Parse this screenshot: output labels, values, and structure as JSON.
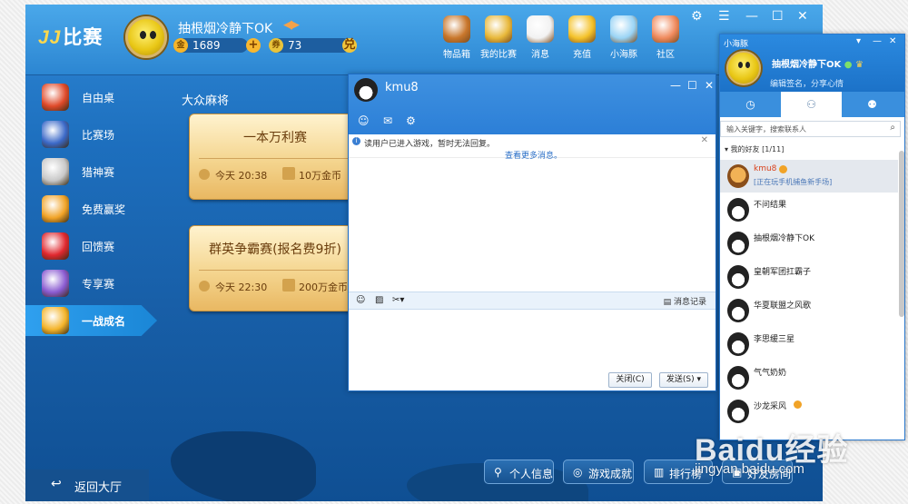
{
  "app": {
    "logo_text": "比赛",
    "username": "抽根烟冷静下OK",
    "coins": "1689",
    "tickets": "73",
    "coin_symbol": "金",
    "ticket_symbol": "兑",
    "icons": [
      {
        "label": "物品箱",
        "icon": "treasure-chest-icon",
        "color": "#c9772c"
      },
      {
        "label": "我的比赛",
        "icon": "trophy-icon",
        "color": "#e8b83a"
      },
      {
        "label": "消息",
        "icon": "megaphone-icon",
        "color": "#f2f2f2"
      },
      {
        "label": "充值",
        "icon": "gold-coins-icon",
        "color": "#f4c22a"
      },
      {
        "label": "小海豚",
        "icon": "dolphin-icon",
        "color": "#9ad4f5"
      },
      {
        "label": "社区",
        "icon": "community-house-icon",
        "color": "#f08a5d"
      }
    ]
  },
  "sidebar": {
    "items": [
      {
        "label": "自由桌",
        "icon": "horse-knight-icon"
      },
      {
        "label": "比赛场",
        "icon": "shield-badge-icon"
      },
      {
        "label": "猎神赛",
        "icon": "crossed-swords-icon"
      },
      {
        "label": "免费赢奖",
        "icon": "gift-box-icon"
      },
      {
        "label": "回馈赛",
        "icon": "heart-icon"
      },
      {
        "label": "专享赛",
        "icon": "medal-icon"
      },
      {
        "label": "一战成名",
        "icon": "cup-icon"
      }
    ],
    "back_label": "返回大厅"
  },
  "main": {
    "section_title": "大众麻将",
    "cards": [
      {
        "title": "一本万利赛",
        "time": "今天 20:38",
        "prize": "10万金币"
      },
      {
        "title": "群英争霸赛(报名费9折)",
        "time": "今天 22:30",
        "prize": "200万金币"
      }
    ],
    "bottom_buttons": [
      "个人信息",
      "游戏成就",
      "排行榜",
      "好友房间"
    ]
  },
  "chat": {
    "contact_name": "kmu8",
    "notice": "读用户已进入游戏，暂时无法回复。",
    "more_link": "查看更多消息。",
    "history_label": "消息记录",
    "close_label": "关闭(C)",
    "send_label": "发送(S)"
  },
  "panel": {
    "title": "小海豚",
    "username": "抽根烟冷静下OK",
    "signature": "编辑签名，分享心情",
    "search_placeholder": "输入关键字，搜索联系人",
    "group_label": "我的好友",
    "group_count": "[1/11]",
    "friends": [
      {
        "name": "kmu8",
        "status": "[正在玩手机捕鱼新手场]",
        "selected": true,
        "online": true,
        "badge": true
      },
      {
        "name": "不问结果",
        "status": "",
        "selected": false,
        "online": false,
        "badge": false
      },
      {
        "name": "抽根烟冷静下OK",
        "status": "",
        "selected": false,
        "online": false,
        "badge": false
      },
      {
        "name": "皇朝军团扛霸子",
        "status": "",
        "selected": false,
        "online": false,
        "badge": false
      },
      {
        "name": "华夏联盟之风歌",
        "status": "",
        "selected": false,
        "online": false,
        "badge": false
      },
      {
        "name": "李思缓三星",
        "status": "",
        "selected": false,
        "online": false,
        "badge": false
      },
      {
        "name": "气气奶奶",
        "status": "",
        "selected": false,
        "online": false,
        "badge": false
      },
      {
        "name": "沙龙采风",
        "status": "",
        "selected": false,
        "online": false,
        "badge": true
      }
    ]
  },
  "watermark": {
    "brand": "Baidu经验",
    "url": "jingyan.baidu.com"
  }
}
